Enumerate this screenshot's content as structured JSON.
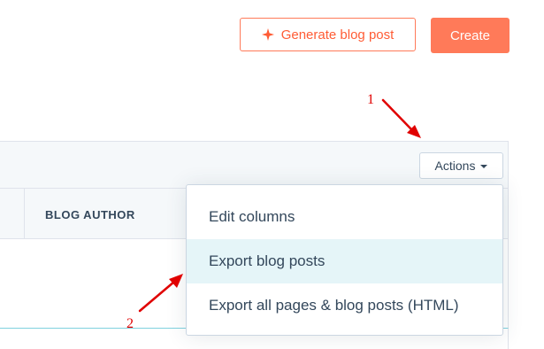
{
  "header": {
    "generate_label": "Generate blog post",
    "create_label": "Create"
  },
  "toolbar": {
    "actions_label": "Actions"
  },
  "table": {
    "columns": [
      "BLOG AUTHOR"
    ]
  },
  "actions_menu": {
    "items": [
      {
        "label": "Edit columns",
        "highlighted": false
      },
      {
        "label": "Export blog posts",
        "highlighted": true
      },
      {
        "label": "Export all pages & blog posts (HTML)",
        "highlighted": false
      }
    ]
  },
  "annotations": {
    "label_1": "1",
    "label_2": "2"
  },
  "colors": {
    "accent": "#ff7a59",
    "annotation": "#e00000",
    "hover": "#e5f5f8"
  }
}
